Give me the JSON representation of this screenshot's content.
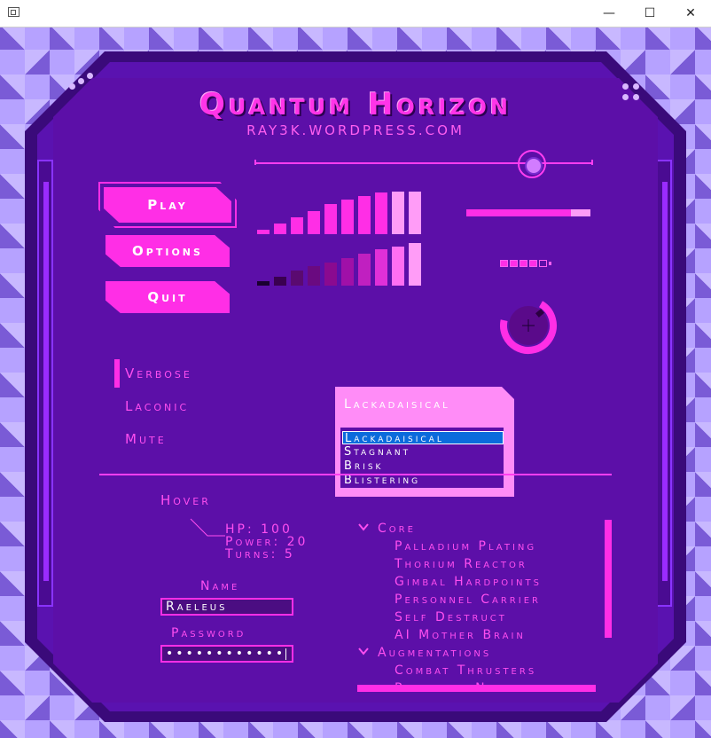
{
  "window": {
    "minimize_glyph": "—",
    "maximize_glyph": "☐",
    "close_glyph": "✕"
  },
  "header": {
    "title": "Quantum Horizon",
    "subtitle": "RAY3K.WORDPRESS.COM"
  },
  "slider": {
    "value": 0.82
  },
  "menu": {
    "play_label": "Play",
    "options_label": "Options",
    "quit_label": "Quit"
  },
  "bar_groups": [
    {
      "colors": "pink-gradient",
      "levels": [
        0.1,
        0.25,
        0.4,
        0.55,
        0.7,
        0.82,
        0.9,
        0.97,
        1.0,
        1.0
      ]
    },
    {
      "colors": "dark-to-pink",
      "levels": [
        0.1,
        0.2,
        0.35,
        0.45,
        0.55,
        0.65,
        0.75,
        0.85,
        0.92,
        1.0
      ]
    }
  ],
  "progress": {
    "value": 0.84,
    "fill_color": "#ff2ee6",
    "track_color": "#ff9cf7"
  },
  "battery": {
    "cells_filled": 4,
    "cells_total": 5
  },
  "knob": {
    "value": 0.7
  },
  "radio": {
    "selected": "Verbose",
    "items": [
      "Verbose",
      "Laconic",
      "Mute"
    ]
  },
  "select": {
    "current": "Lackadaisical",
    "options": [
      "Lackadaisical",
      "Stagnant",
      "Brisk",
      "Blistering"
    ],
    "highlighted": "Lackadaisical"
  },
  "hover": {
    "label": "Hover",
    "tooltip": [
      "HP: 100",
      "Power: 20",
      "Turns: 5"
    ]
  },
  "form": {
    "name_label": "Name",
    "name_value": "Raeleus",
    "password_label": "Password",
    "password_value": "••••••••••••"
  },
  "tree": {
    "groups": [
      {
        "label": "Core",
        "children": [
          "Palladium Plating",
          "Thorium Reactor",
          "Gimbal Hardpoints",
          "Personnel Carrier",
          "Self Destruct",
          "AI Mother Brain"
        ]
      },
      {
        "label": "Augmentations",
        "children": [
          "Combat Thrusters",
          "Reflexive Navigator"
        ]
      }
    ]
  },
  "colors": {
    "accent": "#ff2ee6",
    "panel": "#5c0fa8",
    "frame": "#3a0a7a",
    "highlight": "#0b6bdc"
  }
}
